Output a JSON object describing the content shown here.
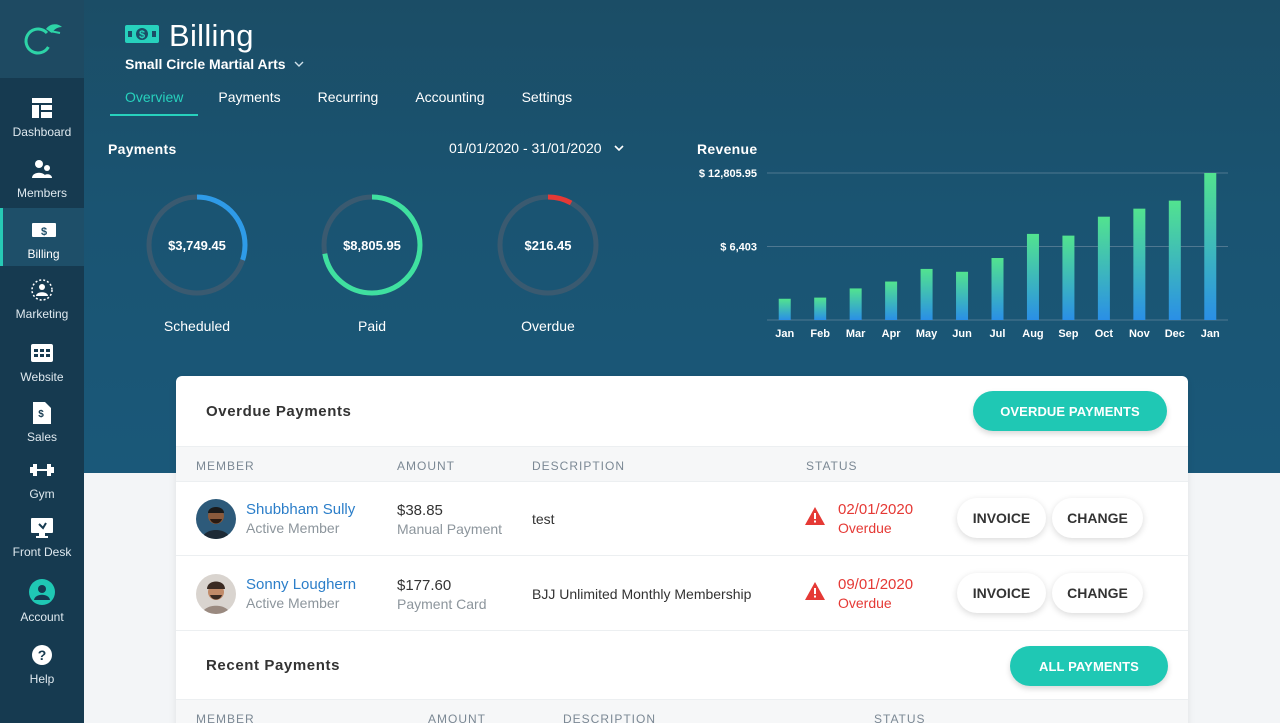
{
  "sidebar": {
    "items": [
      {
        "label": "Dashboard",
        "icon": "dashboard-icon"
      },
      {
        "label": "Members",
        "icon": "members-icon"
      },
      {
        "label": "Billing",
        "icon": "billing-icon",
        "active": true
      },
      {
        "label": "Marketing",
        "icon": "marketing-icon"
      },
      {
        "label": "Website",
        "icon": "website-icon"
      },
      {
        "label": "Sales",
        "icon": "sales-icon"
      },
      {
        "label": "Gym",
        "icon": "dumbbell-icon"
      },
      {
        "label": "Front Desk",
        "icon": "front-desk-icon"
      },
      {
        "label": "Account",
        "icon": "account-icon"
      },
      {
        "label": "Help",
        "icon": "help-icon"
      }
    ]
  },
  "header": {
    "title": "Billing",
    "organization": "Small Circle Martial Arts",
    "tabs": [
      "Overview",
      "Payments",
      "Recurring",
      "Accounting",
      "Settings"
    ]
  },
  "payments": {
    "heading": "Payments",
    "date_range": "01/01/2020 - 31/01/2020",
    "donuts": [
      {
        "value": "$3,749.45",
        "label": "Scheduled",
        "fraction": 0.3,
        "color": "#2e9be8"
      },
      {
        "value": "$8,805.95",
        "label": "Paid",
        "fraction": 0.72,
        "color": "#3fe0a0"
      },
      {
        "value": "$216.45",
        "label": "Overdue",
        "fraction": 0.08,
        "color": "#e53935"
      }
    ]
  },
  "revenue": {
    "heading": "Revenue"
  },
  "chart_data": {
    "type": "bar",
    "title": "Revenue",
    "categories": [
      "Jan",
      "Feb",
      "Mar",
      "Apr",
      "May",
      "Jun",
      "Jul",
      "Aug",
      "Sep",
      "Oct",
      "Nov",
      "Dec",
      "Jan"
    ],
    "values": [
      1850,
      1950,
      2750,
      3350,
      4450,
      4200,
      5400,
      7500,
      7350,
      9000,
      9700,
      10400,
      12805.95
    ],
    "ytick_labels": [
      "$ 12,805.95",
      "$ 6,403"
    ],
    "yticks": [
      12805.95,
      6403
    ],
    "ylim": [
      0,
      12805.95
    ]
  },
  "overdue": {
    "title": "Overdue Payments",
    "button": "OVERDUE PAYMENTS",
    "columns": [
      "MEMBER",
      "AMOUNT",
      "DESCRIPTION",
      "STATUS"
    ],
    "rows": [
      {
        "name": "Shubbham Sully",
        "member_status": "Active Member",
        "amount": "$38.85",
        "method": "Manual Payment",
        "description": "test",
        "due_date": "02/01/2020",
        "status": "Overdue",
        "invoice": "INVOICE",
        "change": "CHANGE"
      },
      {
        "name": "Sonny Loughern",
        "member_status": "Active Member",
        "amount": "$177.60",
        "method": "Payment Card",
        "description": "BJJ Unlimited Monthly Membership",
        "due_date": "09/01/2020",
        "status": "Overdue",
        "invoice": "INVOICE",
        "change": "CHANGE"
      }
    ]
  },
  "recent": {
    "title": "Recent Payments",
    "button": "ALL PAYMENTS",
    "columns": [
      "MEMBER",
      "AMOUNT",
      "DESCRIPTION",
      "STATUS"
    ]
  },
  "colors": {
    "accent": "#1fc8b4",
    "sidebar": "#163a50",
    "overdue": "#e53935",
    "link": "#2b7ec9"
  }
}
